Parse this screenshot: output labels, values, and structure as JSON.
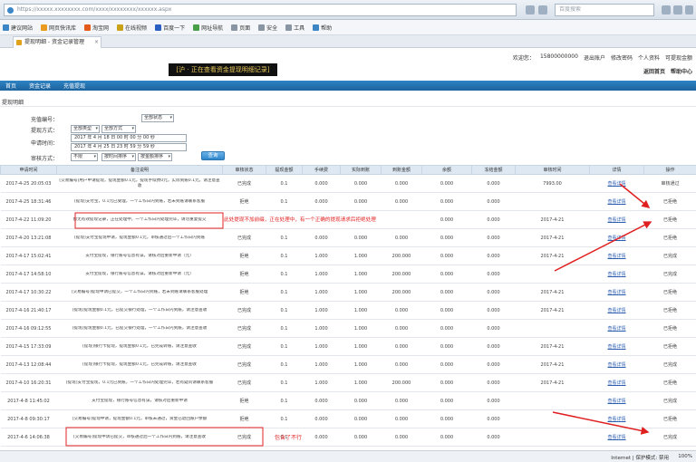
{
  "browser": {
    "url": "https://xxxxx.xxxxxxxx.com/xxxx/xxxxxxxx/xxxxxx.aspx",
    "search_placeholder": "百度搜索",
    "bookmarks": [
      {
        "icon": "ie-icon",
        "label": "建议网站",
        "color": "#3d86c6"
      },
      {
        "icon": "feed-icon",
        "label": "网页快讯库",
        "color": "#e89b1e"
      },
      {
        "icon": "site-icon",
        "label": "淘宝网",
        "color": "#e35a1a"
      },
      {
        "icon": "star-icon",
        "label": "在线视频",
        "color": "#c9a21a"
      },
      {
        "icon": "baidu-icon",
        "label": "百度一下",
        "color": "#2c5fc2"
      },
      {
        "icon": "nav-icon",
        "label": "网址导航",
        "color": "#47a047"
      },
      {
        "icon": "page-icon",
        "label": "页面",
        "color": "#8a95a3"
      },
      {
        "icon": "safe-icon",
        "label": "安全",
        "color": "#8a95a3"
      },
      {
        "icon": "tool-icon",
        "label": "工具",
        "color": "#8a95a3"
      },
      {
        "icon": "help-icon",
        "label": "帮助",
        "color": "#3d86c6"
      }
    ],
    "tab_title": "提现明细 - 资金记录管理",
    "tab_close": "×"
  },
  "header": {
    "label": "[沪 · 正在查看资金提现明细记录]",
    "user_links": [
      "欢迎您：",
      "15800000000",
      "退出账户",
      "修改密码",
      "个人资料",
      "可提现金额"
    ],
    "user_links2": [
      "返回首页",
      "帮助中心"
    ]
  },
  "nav": {
    "items": [
      "首页",
      "资金记录",
      "充值提现"
    ]
  },
  "section_title": "提现明细",
  "filters": {
    "order_label": "充值编号：",
    "status_select": "全部状态",
    "method_label": "提现方式：",
    "method_select1": "全部类型",
    "method_select2": "全部方式",
    "time_label": "申请时间：",
    "date_from": "2017 年 4 月 18 日 00 时 00 分 00 秒",
    "date_to": "2017 年 4 月 25 日 23 时 59 分 59 秒",
    "audit_label": "审核方式：",
    "audit_select1": "不限",
    "audit_select2": "按时间排序",
    "audit_select3": "按金额排序",
    "query_button": "查询"
  },
  "table": {
    "headers": [
      "申请时间",
      "备注说明",
      "审核状态",
      "提现金额",
      "手续费",
      "实际到账",
      "到账金额",
      "余额",
      "冻结金额",
      "审核时间",
      "详情",
      "操作"
    ],
    "rows": [
      {
        "time": "2017-4-25 20:05:03",
        "desc": "[交易编号]用户申请提现，提现金额0.1元，提现手续费0元，实际到账0.1元，请注意查收",
        "status": "已完成",
        "sc": "g",
        "vals": [
          "0.1",
          "0.000",
          "0.000",
          "0.000",
          "0.000",
          "0.000"
        ],
        "audit": "7993.00",
        "view": "查看详情",
        "action": "审核通过",
        "ac": "dark"
      },
      {
        "time": "2017-4-25 18:31:46",
        "desc": "[提现]支付宝，0.1元已受理，一个工作日内到账，若未到账请联系客服",
        "status": "拒绝",
        "sc": "r",
        "vals": [
          "0.1",
          "0.000",
          "0.000",
          "0.000",
          "0.000",
          "0.000"
        ],
        "audit": "",
        "view": "查看详情",
        "action": "已拒绝",
        "ac": "dark"
      },
      {
        "time": "2017-4-22 11:09:20",
        "desc": "暂无有效提现记录，正在处理中，一个工作日内处理完毕，请勿重复提交",
        "status": "",
        "sc": "g",
        "vals": [
          "",
          "",
          "",
          "",
          "0.000",
          "0.000"
        ],
        "audit": "2017-4-21",
        "view": "查看详情",
        "action": "已拒绝",
        "ac": "red"
      },
      {
        "time": "2017-4-20 13:21:08",
        "desc": "[提现]支付宝提现申请，提现金额0.1元，审核通过后一个工作日内到账",
        "status": "已完成",
        "sc": "g",
        "vals": [
          "0.1",
          "0.000",
          "0.000",
          "0.000",
          "0.000",
          "0.000"
        ],
        "audit": "2017-4-21",
        "view": "查看详情",
        "action": "已拒绝",
        "ac": "red"
      },
      {
        "time": "2017-4-17 15:02:41",
        "desc": "支付宝提现，银行账号信息有误，请核对后重新申请（元）",
        "status": "拒绝",
        "sc": "r",
        "vals": [
          "0.1",
          "1.000",
          "1.000",
          "200.000",
          "0.000",
          "0.000"
        ],
        "audit": "2017-4-21",
        "view": "查看详情",
        "action": "已完成",
        "ac": "dark"
      },
      {
        "time": "2017-4-17 14:58:10",
        "desc": "支付宝提现，银行账号信息有误，请核对后重新申请（元）",
        "status": "拒绝",
        "sc": "r",
        "vals": [
          "0.1",
          "1.000",
          "1.000",
          "200.000",
          "0.000",
          "0.000"
        ],
        "audit": "",
        "view": "查看详情",
        "action": "已完成",
        "ac": "dark"
      },
      {
        "time": "2017-4-17 10:30:22",
        "desc": "[交易编号]提现申请已提交，一个工作日内到账，若未到账请联系客服处理",
        "status": "拒绝",
        "sc": "r",
        "vals": [
          "0.1",
          "1.000",
          "1.000",
          "200.000",
          "0.000",
          "0.000"
        ],
        "audit": "2017-4-21",
        "view": "查看详情",
        "action": "已拒绝",
        "ac": "red"
      },
      {
        "time": "2017-4-16 21:40:17",
        "desc": "[提现]提现金额0.1元，已提交银行处理，一个工作日内到账，请注意查收",
        "status": "已完成",
        "sc": "g",
        "vals": [
          "0.1",
          "1.000",
          "1.000",
          "0.000",
          "0.000",
          "0.000"
        ],
        "audit": "2017-4-21",
        "view": "查看详情",
        "action": "已拒绝",
        "ac": "red"
      },
      {
        "time": "2017-4-16 09:12:55",
        "desc": "[提现]提现金额0.1元，已提交银行处理，一个工作日内到账，请注意查收",
        "status": "已完成",
        "sc": "g",
        "vals": [
          "0.1",
          "1.000",
          "1.000",
          "0.000",
          "0.000",
          "0.000"
        ],
        "audit": "",
        "view": "查看详情",
        "action": "已拒绝",
        "ac": "red"
      },
      {
        "time": "2017-4-15 17:33:09",
        "desc": "[提现]银行卡提现，提现金额0.1元，已完成转账，请注意查收",
        "status": "已完成",
        "sc": "g",
        "vals": [
          "0.1",
          "1.000",
          "1.000",
          "0.000",
          "0.000",
          "0.000"
        ],
        "audit": "2017-4-21",
        "view": "查看详情",
        "action": "已拒绝",
        "ac": "red"
      },
      {
        "time": "2017-4-13 12:08:44",
        "desc": "[提现]银行卡提现，提现金额0.1元，已完成转账，请注意查收",
        "status": "已完成",
        "sc": "g",
        "vals": [
          "0.1",
          "1.000",
          "1.000",
          "0.000",
          "0.000",
          "0.000"
        ],
        "audit": "2017-4-21",
        "view": "查看详情",
        "action": "已完成",
        "ac": "dark"
      },
      {
        "time": "2017-4-10 16:20:31",
        "desc": "[提现]支付宝提现，0.1元已到账，一个工作日内处理完毕，若有疑问请联系客服",
        "status": "已完成",
        "sc": "g",
        "vals": [
          "0.1",
          "1.000",
          "1.000",
          "200.000",
          "0.000",
          "0.000"
        ],
        "audit": "2017-4-21",
        "view": "查看详情",
        "action": "已拒绝",
        "ac": "red"
      },
      {
        "time": "2017-4-8 11:45:02",
        "desc": "支付宝提现，银行账号信息有误，请核对后重新申请",
        "status": "拒绝",
        "sc": "r",
        "vals": [
          "0.1",
          "0.000",
          "0.000",
          "0.000",
          "0.000",
          "0.000"
        ],
        "audit": "",
        "view": "查看详情",
        "action": "已完成",
        "ac": "dark"
      },
      {
        "time": "2017-4-8 09:30:17",
        "desc": "[交易编号]提现申请，提现金额0.1元，审核未通过，资金已退回账户余额",
        "status": "拒绝",
        "sc": "r",
        "vals": [
          "0.1",
          "0.000",
          "0.000",
          "0.000",
          "0.000",
          "0.000"
        ],
        "audit": "",
        "view": "查看详情",
        "action": "已拒绝",
        "ac": "red"
      },
      {
        "time": "2017-4-6 14:06:38",
        "desc": "[交易编号]提现申请已提交，审核通过后一个工作日内到账，请注意查收",
        "status": "已完成",
        "sc": "g",
        "vals": [
          "0.1",
          "0.000",
          "0.000",
          "0.000",
          "0.000",
          "0.000"
        ],
        "audit": "",
        "view": "查看详情",
        "action": "已完成",
        "ac": "dark"
      }
    ]
  },
  "annotations": {
    "note1": "此处提现不加前缀，正在处理中，有一个正确的提现请求后拒绝处理",
    "note2": "包含了不行",
    "color": "#e02020"
  },
  "statusbar": {
    "text": "Internet | 保护模式: 禁用",
    "zoom": "100%"
  }
}
